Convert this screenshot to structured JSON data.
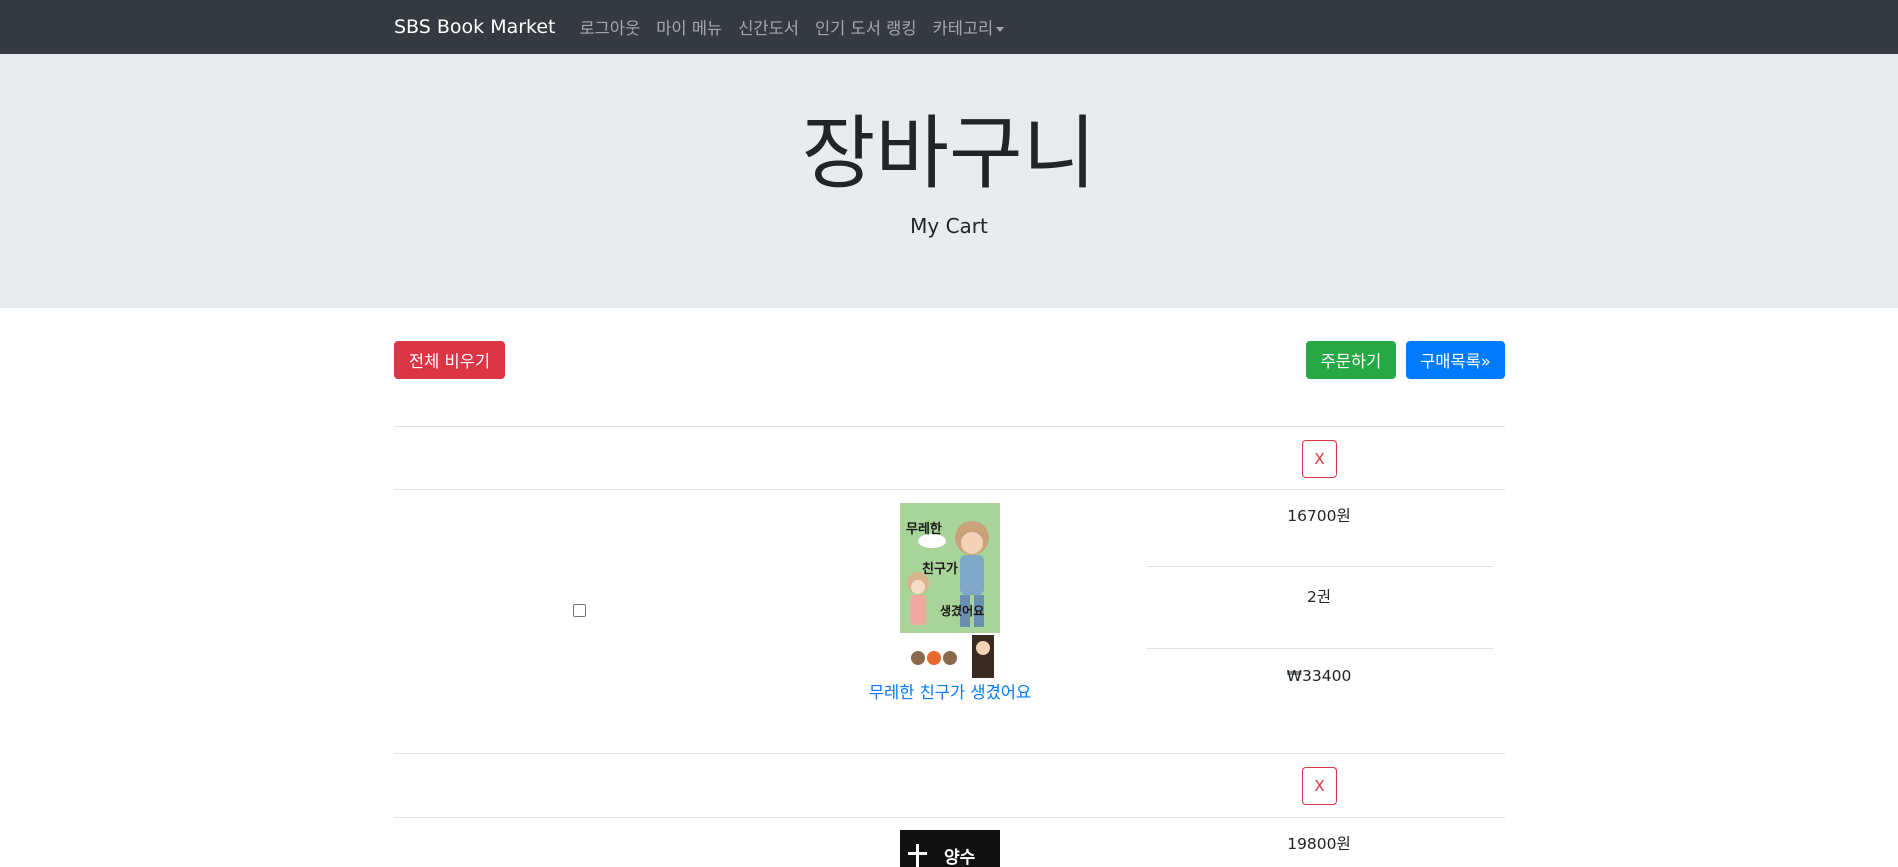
{
  "navbar": {
    "brand": "SBS Book Market",
    "links": [
      "로그아웃",
      "마이 메뉴",
      "신간도서",
      "인기 도서 랭킹",
      "카테고리"
    ]
  },
  "jumbotron": {
    "title": "장바구니",
    "subtitle": "My Cart"
  },
  "actions": {
    "clear_label": "전체 비우기",
    "order_label": "주문하기",
    "history_label": "구매목록»"
  },
  "cart": {
    "items": [
      {
        "remove_label": "X",
        "title": "무레한 친구가 생겼어요",
        "price": "16700원",
        "quantity": "2권",
        "total": "₩33400",
        "cover_text": [
          "무레한",
          "친구가",
          "생겼어요"
        ]
      },
      {
        "remove_label": "X",
        "price": "19800원",
        "cover_text": [
          "양수"
        ]
      }
    ]
  },
  "colors": {
    "navbar": "#343a40",
    "jumbotron": "#e9ecef",
    "danger": "#dc3545",
    "success": "#28a745",
    "primary": "#007bff"
  }
}
